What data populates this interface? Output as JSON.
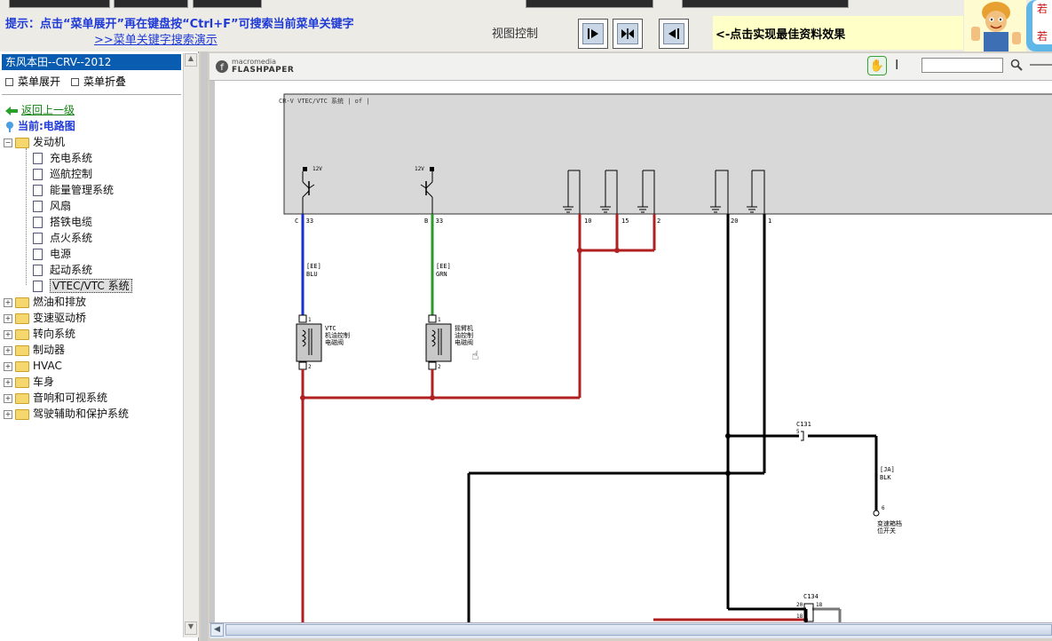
{
  "header": {
    "hint": "提示：点击“菜单展开”再在键盘按“Ctrl+F”可搜索当前菜单关键字",
    "search_demo_link": ">>菜单关键字搜索演示",
    "view_control_label": "视图控制",
    "best_effect_label": "<-点击实现最佳资料效果",
    "right_text_1": "若",
    "right_text_2": "若"
  },
  "sidebar": {
    "title": "东风本田--CRV--2012",
    "expand_label": "菜单展开",
    "collapse_label": "菜单折叠",
    "back_label": "返回上一级",
    "current_label": "当前:电路图",
    "tree": {
      "engine": {
        "label": "发动机",
        "children": [
          "充电系统",
          "巡航控制",
          "能量管理系统",
          "风扇",
          "搭铁电缆",
          "点火系统",
          "电源",
          "起动系统",
          "VTEC/VTC 系统"
        ]
      },
      "folders": [
        "燃油和排放",
        "变速驱动桥",
        "转向系统",
        "制动器",
        "HVAC",
        "车身",
        "音响和可视系统",
        "驾驶辅助和保护系统"
      ]
    }
  },
  "viewer": {
    "logo_small": "macromedia",
    "logo_big": "FLASHPAPER",
    "search_placeholder": ""
  },
  "diagram": {
    "page_header": "CR-V VTEC/VTC 系统 | of |",
    "v12_a": "12V",
    "v12_b": "12V",
    "conn_c33": "C  33",
    "conn_b33": "B  33",
    "pin_10": "10",
    "pin_15": "15",
    "pin_2": "2",
    "pin_20": "20",
    "pin_1": "1",
    "wire_code_1": "[EE]",
    "wire_color_1": "BLU",
    "wire_code_2": "[EE]",
    "wire_color_2": "GRN",
    "valve_1_line1": "VTC",
    "valve_1_line2": "机油控制",
    "valve_1_line3": "电磁阀",
    "valve_2_line1": "摇臂机",
    "valve_2_line2": "油控制",
    "valve_2_line3": "电磁阀",
    "valve_pin_top": "1",
    "valve_pin_bottom": "2",
    "conn_c131": "C131",
    "pin_5": "5",
    "wire_code_3": "[JA]",
    "wire_color_3": "BLK",
    "pin_6": "6",
    "switch_line1": "变速箱档",
    "switch_line2": "位开关",
    "conn_c134": "C134",
    "pin_20b": "20",
    "pin_18": "18"
  }
}
